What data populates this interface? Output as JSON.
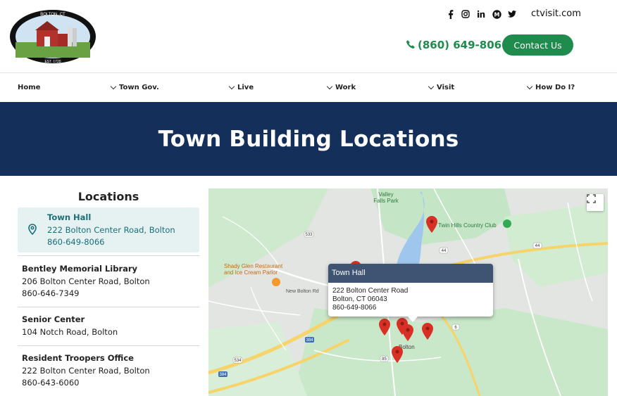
{
  "header": {
    "logo_top_text": "BOLTON, CT",
    "logo_bottom_text": "EST. 1720",
    "social_icons": [
      "facebook-icon",
      "instagram-icon",
      "linkedin-icon",
      "threads-icon",
      "twitter-icon"
    ],
    "ctvisit_link": "ctvisit.com",
    "phone": "(860) 649-8066",
    "contact_label": "Contact Us",
    "accent_color": "#1f8b4c"
  },
  "nav": {
    "items": [
      {
        "label": "Home",
        "dropdown": false
      },
      {
        "label": "Town Gov.",
        "dropdown": true
      },
      {
        "label": "Live",
        "dropdown": true
      },
      {
        "label": "Work",
        "dropdown": true
      },
      {
        "label": "Visit",
        "dropdown": true
      },
      {
        "label": "How Do I?",
        "dropdown": true
      }
    ]
  },
  "hero": {
    "title": "Town Building Locations",
    "background_color": "#14305a"
  },
  "locations": {
    "heading": "Locations",
    "items": [
      {
        "name": "Town Hall",
        "address": "222 Bolton Center Road, Bolton",
        "phone": "860-649-8066",
        "selected": true
      },
      {
        "name": "Bentley Memorial Library",
        "address": "206 Bolton Center Road, Bolton",
        "phone": "860-646-7349",
        "selected": false
      },
      {
        "name": "Senior Center",
        "address": "104 Notch Road, Bolton",
        "phone": "",
        "selected": false
      },
      {
        "name": "Resident Troopers Office",
        "address": "222 Bolton Center Road, Bolton",
        "phone": "860-643-6060",
        "selected": false
      }
    ]
  },
  "map": {
    "popup": {
      "title": "Town Hall",
      "line1": "222 Bolton Center Road",
      "line2": "Bolton, CT 06043",
      "line3": "860-649-8066"
    },
    "labels": {
      "valley_falls": "Valley Falls Park",
      "twin_hills": "Twin Hills Country Club",
      "shady_glen": "Shady Glen Restaurant and Ice Cream Parlor",
      "new_bolton": "New Bolton Rd",
      "bolton": "Bolton"
    },
    "route_shields": [
      "533",
      "44",
      "44",
      "6",
      "384",
      "85",
      "534",
      "384"
    ],
    "marker_color": "#d93025"
  }
}
